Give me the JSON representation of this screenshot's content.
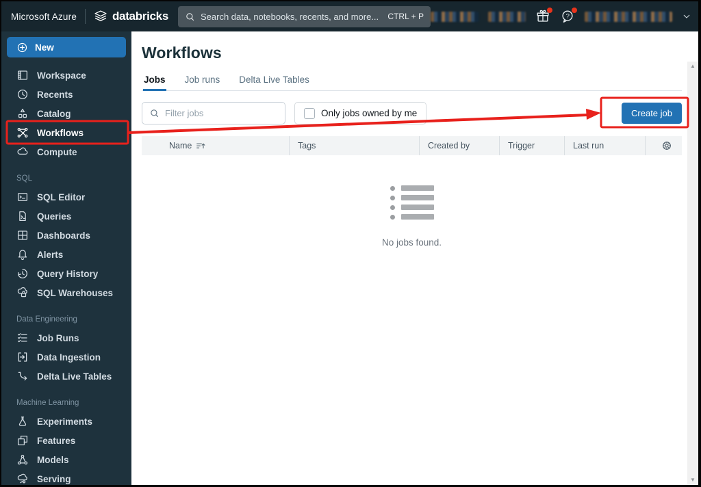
{
  "topbar": {
    "product": "Microsoft Azure",
    "brand": "databricks",
    "search_placeholder": "Search data, notebooks, recents, and more...",
    "search_shortcut": "CTRL + P"
  },
  "sidebar": {
    "new_button_label": "New",
    "sections": [
      {
        "label": "",
        "items": [
          {
            "label": "Workspace",
            "icon": "workspace-icon"
          },
          {
            "label": "Recents",
            "icon": "recents-icon"
          },
          {
            "label": "Catalog",
            "icon": "catalog-icon"
          },
          {
            "label": "Workflows",
            "icon": "workflows-icon",
            "active": true
          },
          {
            "label": "Compute",
            "icon": "compute-icon"
          }
        ]
      },
      {
        "label": "SQL",
        "items": [
          {
            "label": "SQL Editor",
            "icon": "sql-editor-icon"
          },
          {
            "label": "Queries",
            "icon": "queries-icon"
          },
          {
            "label": "Dashboards",
            "icon": "dashboards-icon"
          },
          {
            "label": "Alerts",
            "icon": "alerts-icon"
          },
          {
            "label": "Query History",
            "icon": "query-history-icon"
          },
          {
            "label": "SQL Warehouses",
            "icon": "sql-warehouses-icon"
          }
        ]
      },
      {
        "label": "Data Engineering",
        "items": [
          {
            "label": "Job Runs",
            "icon": "job-runs-icon"
          },
          {
            "label": "Data Ingestion",
            "icon": "data-ingestion-icon"
          },
          {
            "label": "Delta Live Tables",
            "icon": "delta-live-tables-icon"
          }
        ]
      },
      {
        "label": "Machine Learning",
        "items": [
          {
            "label": "Experiments",
            "icon": "experiments-icon"
          },
          {
            "label": "Features",
            "icon": "features-icon"
          },
          {
            "label": "Models",
            "icon": "models-icon"
          },
          {
            "label": "Serving",
            "icon": "serving-icon"
          }
        ]
      }
    ]
  },
  "main": {
    "title": "Workflows",
    "tabs": [
      {
        "label": "Jobs",
        "active": true
      },
      {
        "label": "Job runs",
        "active": false
      },
      {
        "label": "Delta Live Tables",
        "active": false
      }
    ],
    "filter_placeholder": "Filter jobs",
    "owned_checkbox_label": "Only jobs owned by me",
    "owned_checkbox_checked": false,
    "create_button_label": "Create job",
    "table_columns": [
      "Name",
      "Tags",
      "Created by",
      "Trigger",
      "Last run"
    ],
    "empty_message": "No jobs found."
  },
  "colors": {
    "accent_blue": "#2272b4",
    "annotation_red": "#e8211c",
    "topbar_bg": "#17262e",
    "sidebar_bg": "#1e323d"
  }
}
